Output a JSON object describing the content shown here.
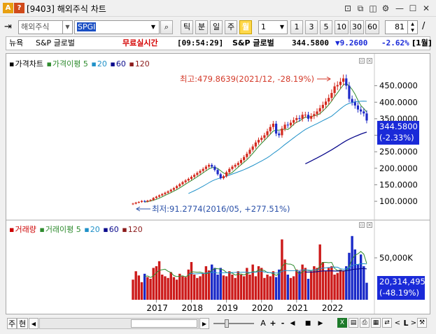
{
  "window": {
    "title": "[9403] 해외주식 차트"
  },
  "toolbar": {
    "market": "해외주식",
    "symbol": "SPGI",
    "period_buttons": [
      "틱",
      "분",
      "일",
      "주",
      "월"
    ],
    "period_active": "월",
    "interval_value": "1",
    "interval_buttons": [
      "1",
      "3",
      "5",
      "10",
      "30",
      "60"
    ],
    "count_value": "81",
    "slash": "/"
  },
  "info": {
    "exchange": "뉴욕",
    "name": "S&P 글로벌",
    "realtime_label": "무료실시간",
    "time": "[09:54:29]",
    "name2": "S&P 글로벌",
    "price": "344.5800",
    "change": "▼9.2600",
    "change_pct": "-2.62%",
    "period_tag": "[1월]"
  },
  "price_pane": {
    "legend": [
      {
        "label": "가격차트",
        "color": "#000000"
      },
      {
        "label": "가격이평 5",
        "color": "#2e8b2e"
      },
      {
        "label": "20",
        "color": "#1e90c8"
      },
      {
        "label": "60",
        "color": "#0a0a8c"
      },
      {
        "label": "120",
        "color": "#8b1a1a"
      }
    ],
    "high_annotation": "최고:479.8639(2021/12, -28.19%)",
    "low_annotation": "최저:91.2774(2016/05, +277.51%)",
    "current_value": "344.5800",
    "current_pct": "(-2.33%)"
  },
  "volume_pane": {
    "legend": [
      {
        "label": "거래량",
        "color": "#cc0000"
      },
      {
        "label": "거래이평 5",
        "color": "#2e8b2e"
      },
      {
        "label": "20",
        "color": "#1e90c8"
      },
      {
        "label": "60",
        "color": "#0a0a8c"
      },
      {
        "label": "120",
        "color": "#8b1a1a"
      }
    ],
    "current_value": "20,314,495",
    "current_pct": "(-48.19%)"
  },
  "chart_data": [
    {
      "type": "candlestick",
      "title": "",
      "y_ticks": [
        100,
        150,
        200,
        250,
        300,
        350,
        400,
        450
      ],
      "y_tick_labels": [
        "100.0000",
        "150.0000",
        "200.0000",
        "250.0000",
        "300.0000",
        "350.0000",
        "400.0000",
        "450.0000"
      ],
      "ylim": [
        60,
        500
      ],
      "x_tick_labels": [
        "2017",
        "2018",
        "2019",
        "2020",
        "2021",
        "2022"
      ],
      "series": [
        {
          "name": "가격차트",
          "start": "2016/05",
          "frequency": "monthly",
          "close": [
            93,
            96,
            98,
            101,
            99,
            102,
            104,
            110,
            114,
            118,
            122,
            126,
            130,
            135,
            140,
            146,
            152,
            158,
            163,
            168,
            174,
            180,
            186,
            192,
            198,
            205,
            210,
            205,
            195,
            182,
            170,
            176,
            188,
            198,
            205,
            210,
            216,
            225,
            234,
            244,
            256,
            266,
            278,
            286,
            292,
            300,
            312,
            325,
            335,
            305,
            300,
            320,
            332,
            330,
            338,
            346,
            352,
            350,
            362,
            362,
            350,
            358,
            364,
            372,
            382,
            392,
            402,
            413,
            428,
            448,
            452,
            462,
            472,
            450,
            410,
            400,
            390,
            378,
            372,
            366,
            344.58
          ]
        }
      ]
    },
    {
      "type": "bar",
      "title": "",
      "y_ticks": [
        50000000
      ],
      "y_tick_labels": [
        "50,000K"
      ],
      "series": [
        {
          "name": "거래량",
          "start": "2016/05",
          "frequency": "monthly",
          "values": [
            24,
            34,
            29,
            21,
            31,
            27,
            25,
            38,
            40,
            46,
            30,
            28,
            26,
            33,
            27,
            24,
            31,
            28,
            27,
            36,
            45,
            30,
            26,
            28,
            31,
            40,
            35,
            42,
            38,
            30,
            38,
            29,
            28,
            34,
            30,
            26,
            34,
            30,
            28,
            38,
            30,
            42,
            28,
            40,
            38,
            26,
            30,
            28,
            34,
            27,
            36,
            72,
            48,
            30,
            26,
            28,
            36,
            34,
            42,
            38,
            25,
            34,
            40,
            38,
            66,
            45,
            34,
            38,
            40,
            30,
            32,
            36,
            34,
            40,
            56,
            76,
            60,
            42,
            54,
            40,
            20.3
          ]
        }
      ]
    }
  ],
  "bottombar": {
    "left_labels": [
      "주",
      "현"
    ],
    "right_tools": [
      "A",
      "+",
      "-",
      "◀",
      "■",
      "▶"
    ]
  }
}
